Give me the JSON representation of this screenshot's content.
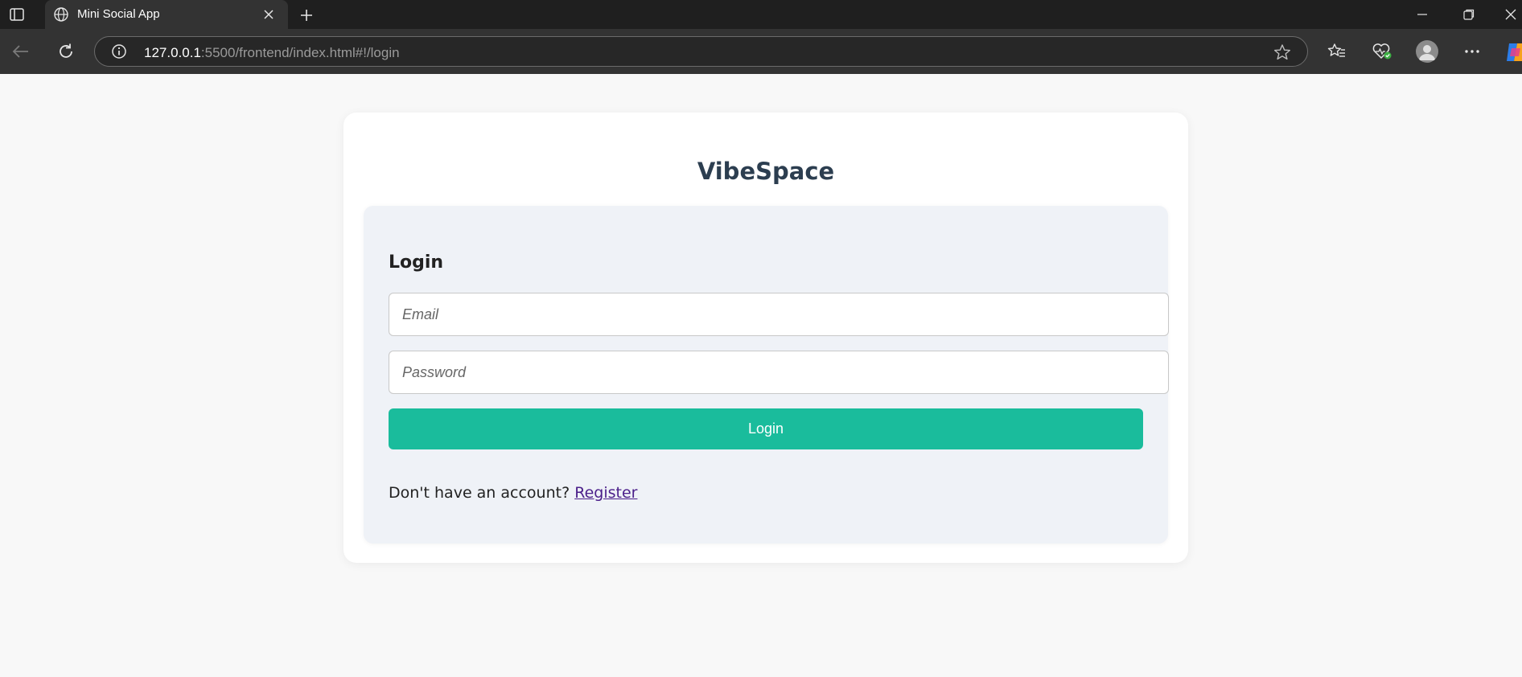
{
  "browser": {
    "tab_title": "Mini Social App",
    "url_host": "127.0.0.1",
    "url_rest": ":5500/frontend/index.html#!/login",
    "icons": [
      "tab-actions-icon",
      "globe-icon",
      "close-icon",
      "plus-icon",
      "minimize-icon",
      "restore-icon",
      "close-window-icon",
      "back-arrow-icon",
      "refresh-icon",
      "info-icon",
      "star-icon",
      "favorites-icon",
      "browser-essentials-icon",
      "profile-avatar-icon",
      "more-options-icon",
      "copilot-icon"
    ]
  },
  "app": {
    "brand": "VibeSpace"
  },
  "login": {
    "title": "Login",
    "email_placeholder": "Email",
    "password_placeholder": "Password",
    "submit_label": "Login",
    "no_account_text": "Don't have an account?",
    "register_label": "Register"
  },
  "colors": {
    "accent": "#1abc9c",
    "brand_text": "#2c3e50",
    "panel_bg": "#eff2f7",
    "link": "#4b1f8a"
  }
}
